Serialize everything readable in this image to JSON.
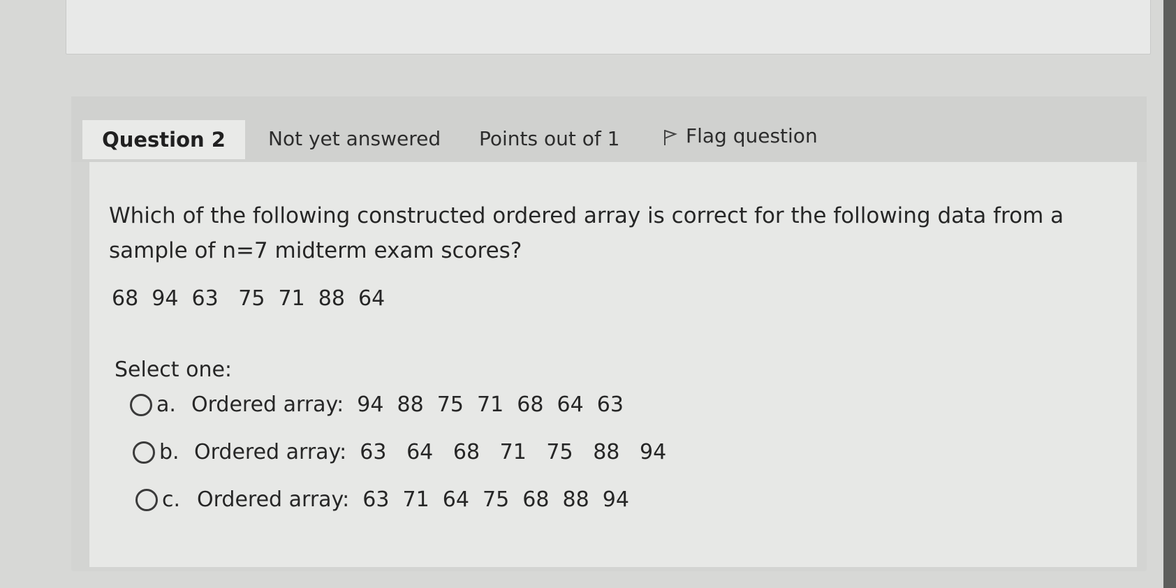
{
  "question": {
    "number_label": "Question 2",
    "status": "Not yet answered",
    "points": "Points out of 1",
    "flag_label": "Flag question",
    "text": "Which of the following constructed ordered array is correct for the following data from a sample of n=7 midterm exam scores?",
    "data_values": "68  94  63   75  71  88  64",
    "select_prompt": "Select one:",
    "options": [
      {
        "letter": "a.",
        "text": "Ordered array:  94  88  75  71  68  64  63"
      },
      {
        "letter": "b.",
        "text": "Ordered array:  63   64   68   71   75   88   94"
      },
      {
        "letter": "c.",
        "text": "Ordered array:  63  71  64  75  68  88  94"
      }
    ]
  },
  "icons": {
    "flag": "flag-icon",
    "radio": "radio-circle-icon"
  },
  "colors": {
    "background": "#d7d8d6",
    "card_body": "#e7e8e6",
    "header_tab": "#e9eae8"
  }
}
